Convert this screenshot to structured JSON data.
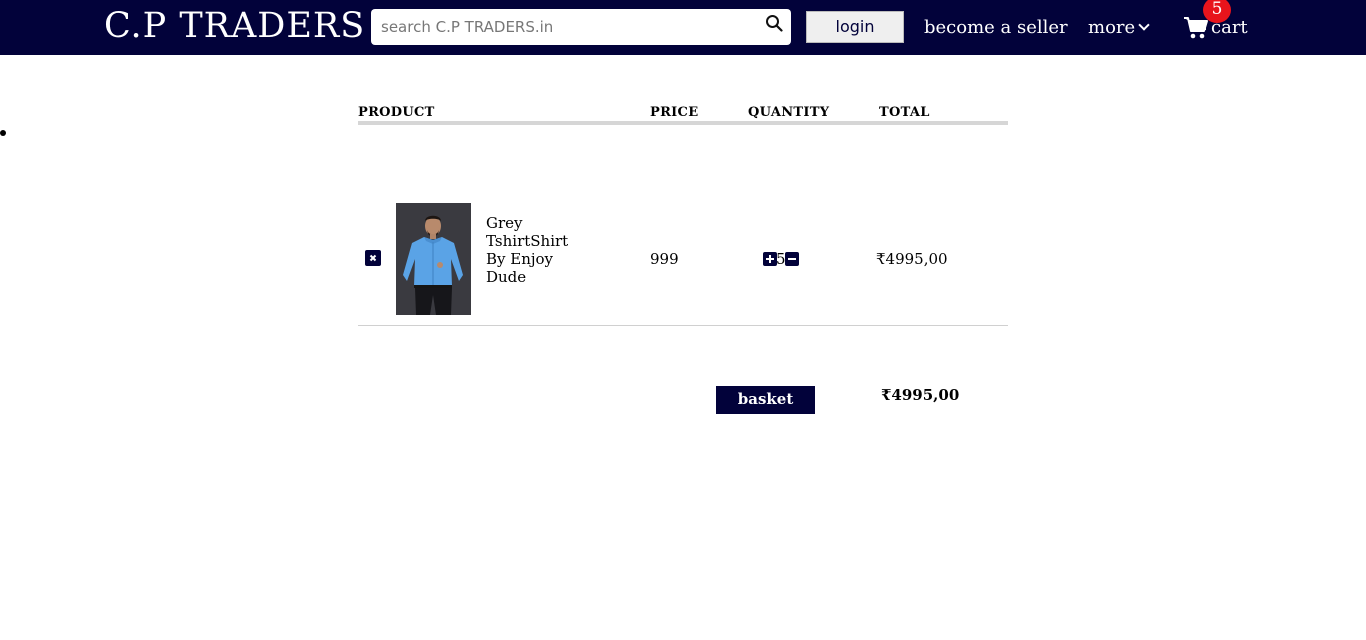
{
  "header": {
    "logo": "C.P TRADERS",
    "search_placeholder": "search C.P TRADERS.in",
    "login_label": "login",
    "seller_label": "become a seller",
    "more_label": "more",
    "cart_label": "cart",
    "cart_count": "5"
  },
  "cart_table": {
    "columns": [
      "PRODUCT",
      "PRICE",
      "QUANTITY",
      "TOTAL"
    ],
    "items": [
      {
        "name": "Grey TshirtShirt By Enjoy Dude",
        "price": "999",
        "quantity": "5",
        "total": "₹4995,00"
      }
    ]
  },
  "summary": {
    "label": "basket total",
    "total": "₹4995,00"
  },
  "colors": {
    "navbar": "#02023a",
    "badge": "#e8141c",
    "shirt": "#5aa3e6"
  }
}
